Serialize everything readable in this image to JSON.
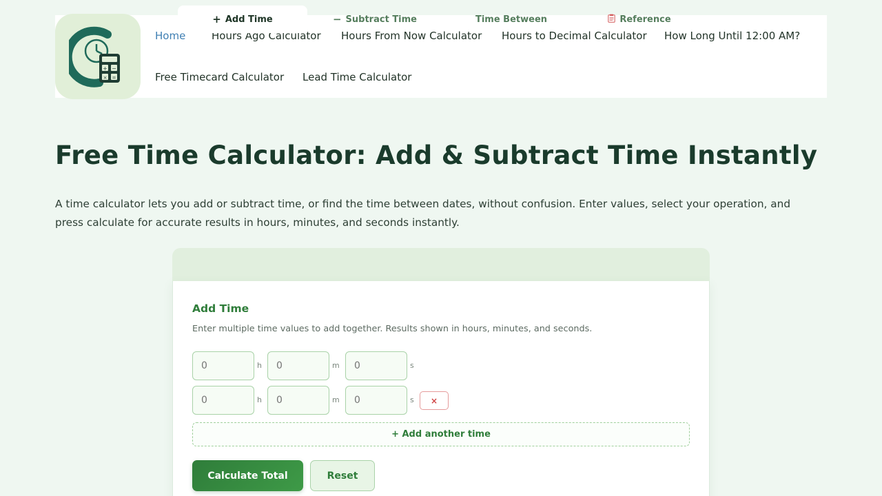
{
  "nav": {
    "items": [
      {
        "label": "Home"
      },
      {
        "label": "Hours Ago Calculator"
      },
      {
        "label": "Hours From Now Calculator"
      },
      {
        "label": "Hours to Decimal Calculator"
      },
      {
        "label": "How Long Until 12:00 AM?"
      },
      {
        "label": "Free Timecard Calculator"
      },
      {
        "label": "Lead Time Calculator"
      }
    ]
  },
  "page": {
    "title": "Free Time Calculator: Add & Subtract Time Instantly",
    "intro": "A time calculator lets you add or subtract time, or find the time between dates, without confusion. Enter values, select your operation, and press calculate for accurate results in hours, minutes, and seconds instantly."
  },
  "calculator": {
    "tabs": [
      {
        "label": "Add Time",
        "icon": "+"
      },
      {
        "label": "Subtract Time",
        "icon": "−"
      },
      {
        "label": "Time Between",
        "icon": ""
      },
      {
        "label": "Reference",
        "icon": "📋"
      }
    ],
    "section_title": "Add Time",
    "section_desc": "Enter multiple time values to add together. Results shown in hours, minutes, and seconds.",
    "units": {
      "h": "h",
      "m": "m",
      "s": "s"
    },
    "rows": [
      {
        "hours": "0",
        "minutes": "0",
        "seconds": "0"
      },
      {
        "hours": "0",
        "minutes": "0",
        "seconds": "0"
      }
    ],
    "remove_label": "×",
    "add_another_label": "+ Add another time",
    "calculate_label": "Calculate Total",
    "reset_label": "Reset"
  },
  "colors": {
    "accent": "#2f7d3a",
    "background": "#eff7f1",
    "link_active": "#3f7fb3"
  }
}
